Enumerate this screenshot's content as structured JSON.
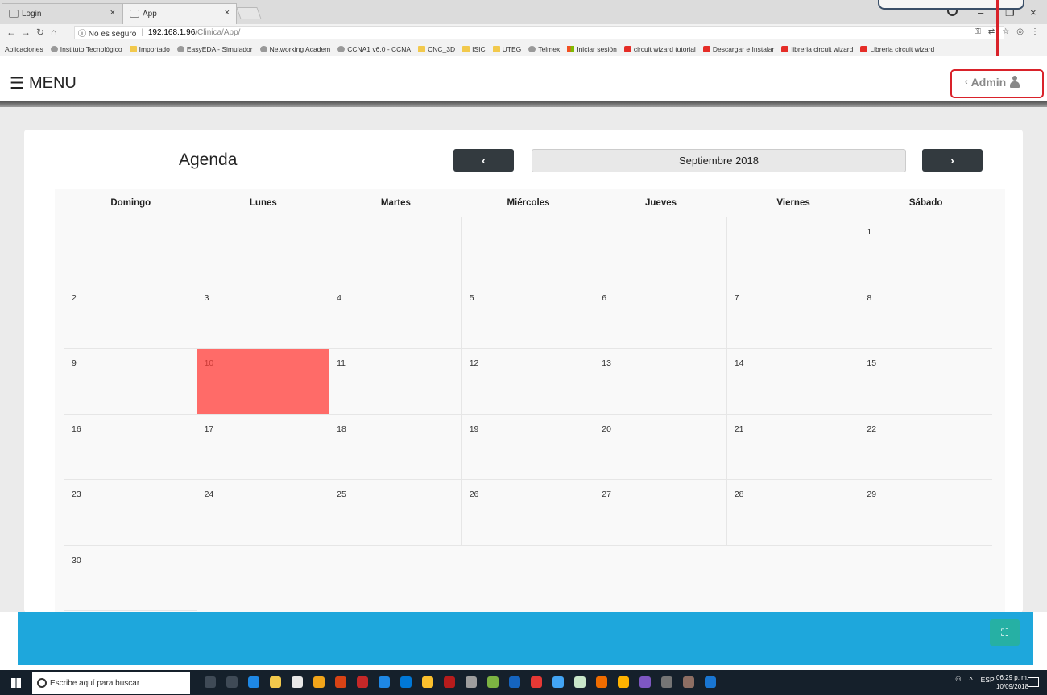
{
  "browser": {
    "tabs": [
      {
        "label": "Login"
      },
      {
        "label": "App"
      }
    ],
    "address": {
      "security": "ⓘ No es seguro",
      "host": "192.168.1.96",
      "path": "/Clinica/App/"
    },
    "bookmarks": [
      {
        "label": "Aplicaciones",
        "icon": "grid-icon"
      },
      {
        "label": "Instituto Tecnológico",
        "icon": "generic-icon"
      },
      {
        "label": "Importado",
        "icon": "folder-icon"
      },
      {
        "label": "EasyEDA - Simulador",
        "icon": "generic-icon"
      },
      {
        "label": "Networking Academ",
        "icon": "generic-icon"
      },
      {
        "label": "CCNA1 v6.0 - CCNA",
        "icon": "generic-icon"
      },
      {
        "label": "CNC_3D",
        "icon": "folder-icon"
      },
      {
        "label": "ISIC",
        "icon": "folder-icon"
      },
      {
        "label": "UTEG",
        "icon": "folder-icon"
      },
      {
        "label": "Telmex",
        "icon": "generic-icon"
      },
      {
        "label": "Iniciar sesión",
        "icon": "windows-icon"
      },
      {
        "label": "circuit wizard tutorial",
        "icon": "youtube-icon"
      },
      {
        "label": "Descargar e Instalar",
        "icon": "youtube-icon"
      },
      {
        "label": "libreria circuit wizard",
        "icon": "youtube-icon"
      },
      {
        "label": "Libreria circuit wizard",
        "icon": "youtube-icon"
      }
    ]
  },
  "header": {
    "menu_label": "MENU",
    "user_label": "Admin"
  },
  "agenda": {
    "title": "Agenda",
    "month": "Septiembre 2018",
    "prev_label": "‹",
    "next_label": "›",
    "weekdays": [
      "Domingo",
      "Lunes",
      "Martes",
      "Miércoles",
      "Jueves",
      "Viernes",
      "Sábado"
    ],
    "weeks": [
      [
        "",
        "",
        "",
        "",
        "",
        "",
        "1"
      ],
      [
        "2",
        "3",
        "4",
        "5",
        "6",
        "7",
        "8"
      ],
      [
        "9",
        "10",
        "11",
        "12",
        "13",
        "14",
        "15"
      ],
      [
        "16",
        "17",
        "18",
        "19",
        "20",
        "21",
        "22"
      ],
      [
        "23",
        "24",
        "25",
        "26",
        "27",
        "28",
        "29"
      ],
      [
        "30"
      ]
    ],
    "today": "10",
    "today_color": "#ff6b68"
  },
  "taskbar": {
    "search_placeholder": "Escribe aquí para buscar",
    "language": "ESP",
    "time": "06:29 p. m.",
    "date": "10/09/2018"
  },
  "colors": {
    "accent_blue": "#1ea7dc",
    "nav_button": "#333a3f",
    "highlight_red": "#d9222a"
  }
}
